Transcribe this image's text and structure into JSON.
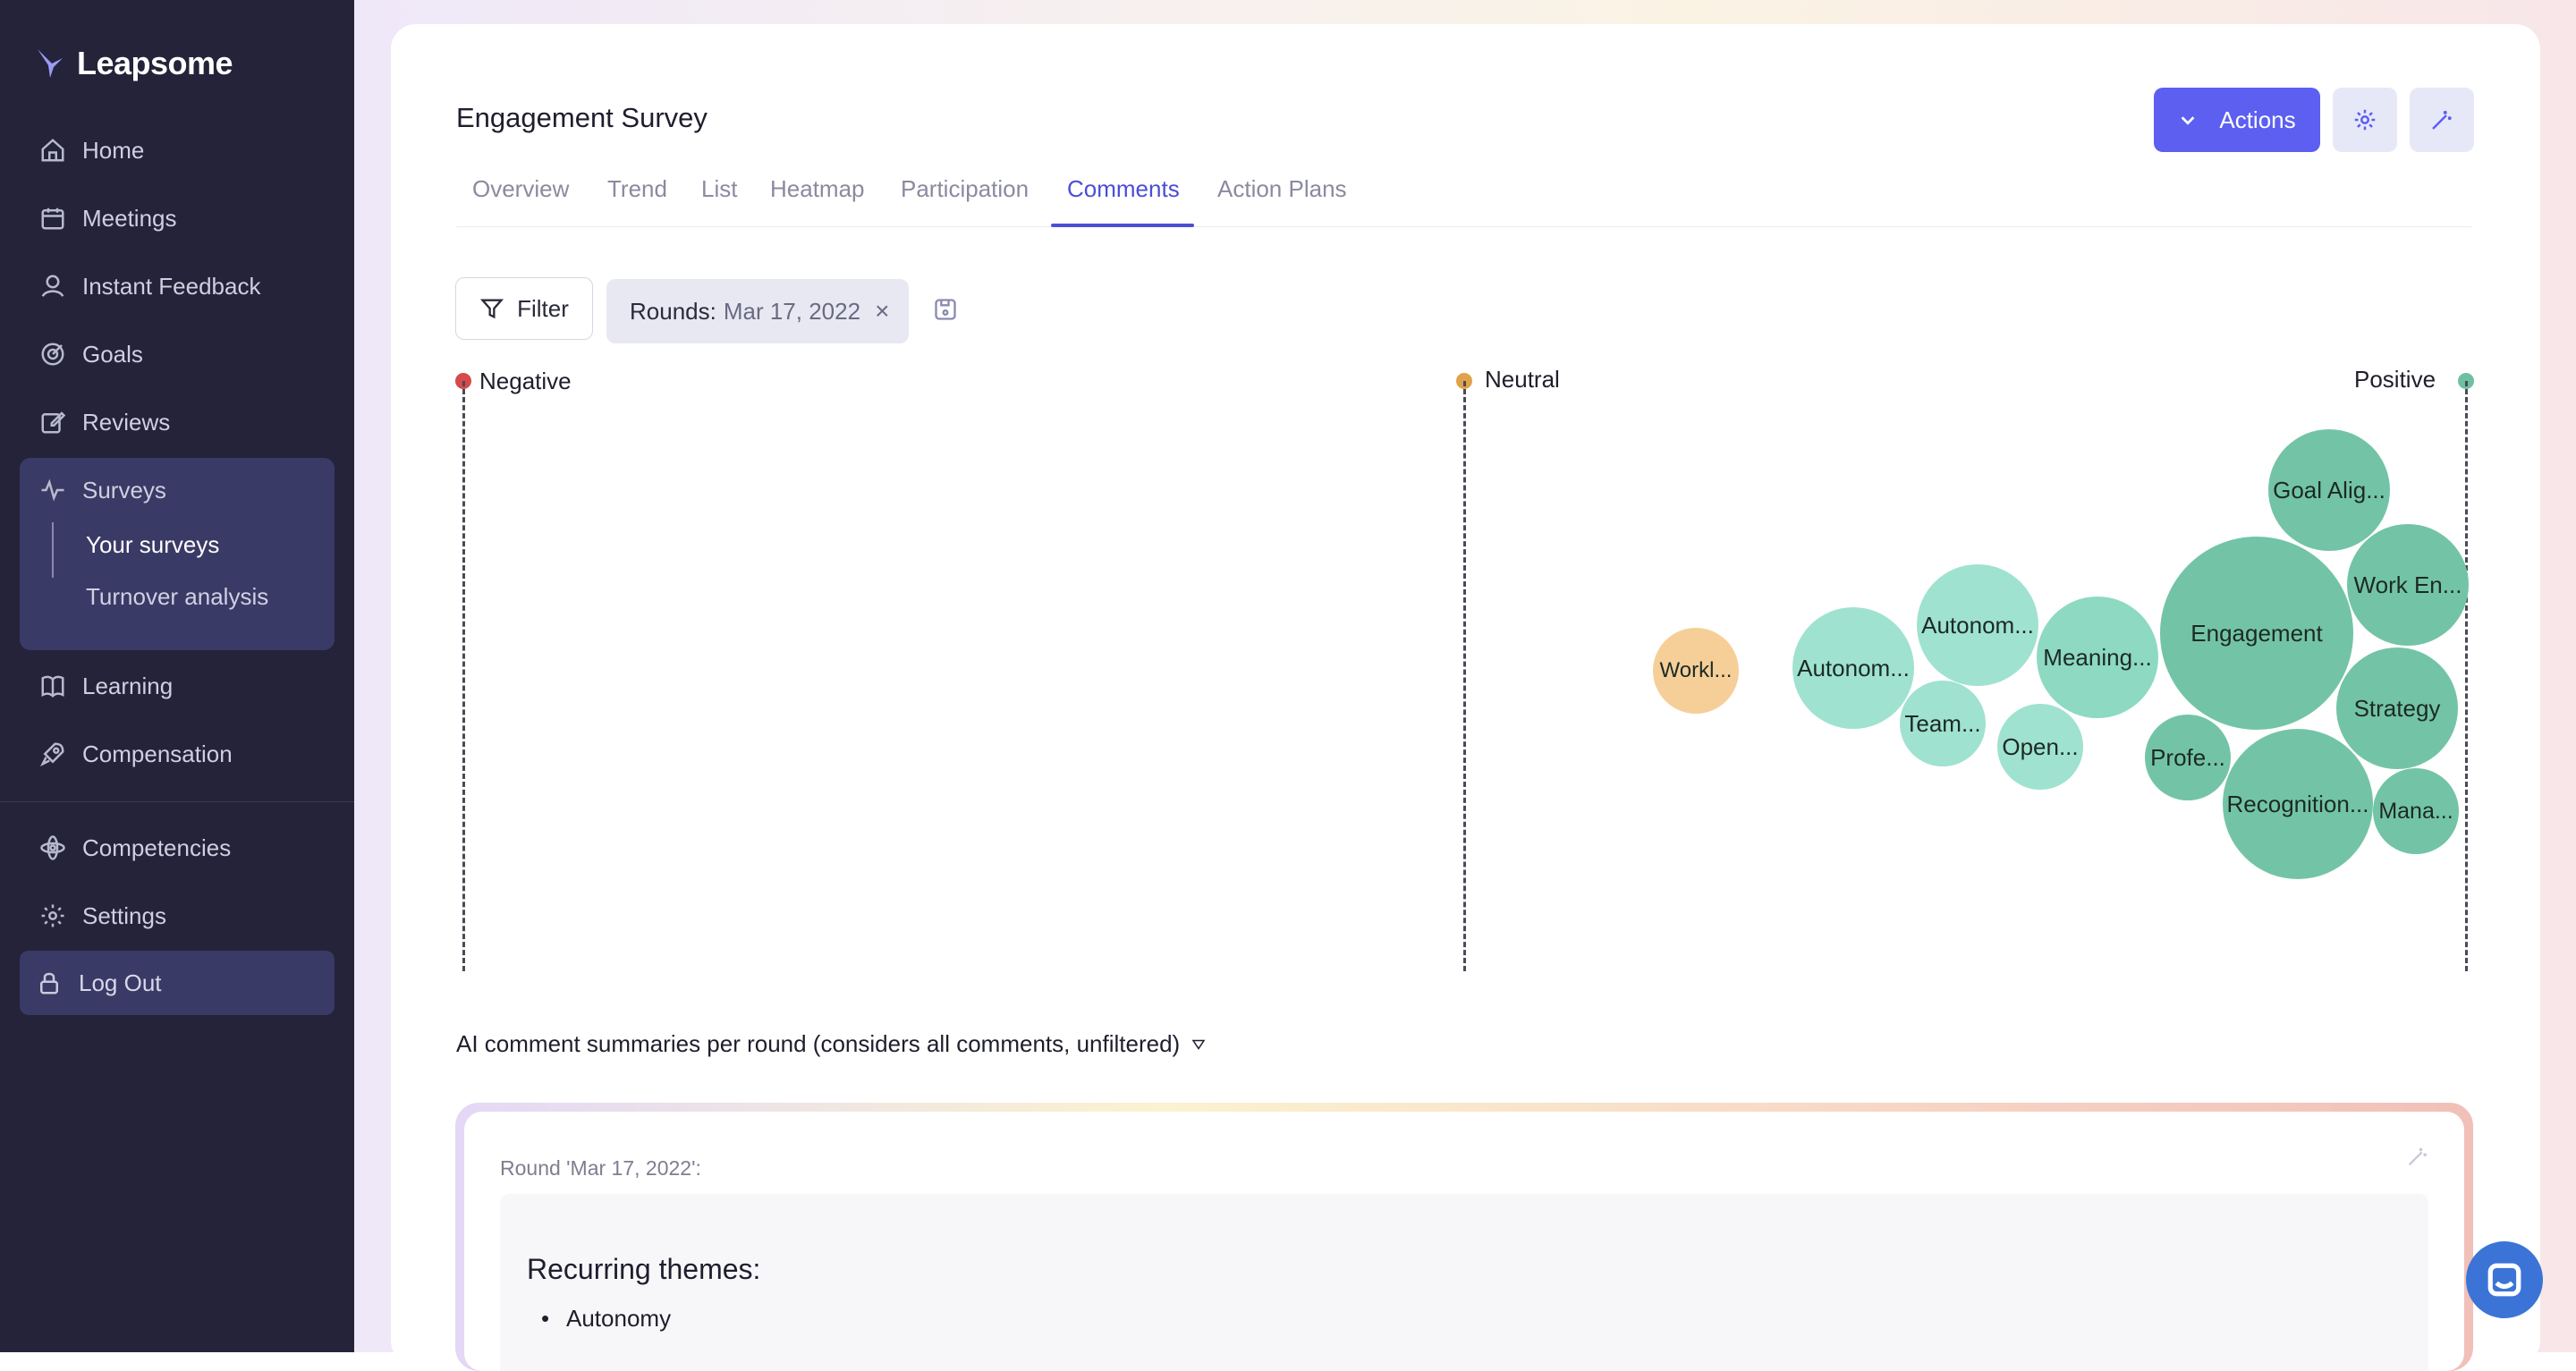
{
  "app": {
    "logo_text": "Leapsome"
  },
  "sidebar": {
    "items": [
      {
        "label": "Home",
        "icon": "home-icon"
      },
      {
        "label": "Meetings",
        "icon": "calendar-icon"
      },
      {
        "label": "Instant Feedback",
        "icon": "feedback-icon"
      },
      {
        "label": "Goals",
        "icon": "target-icon"
      },
      {
        "label": "Reviews",
        "icon": "edit-icon"
      },
      {
        "label": "Surveys",
        "icon": "pulse-icon"
      },
      {
        "label": "Learning",
        "icon": "book-icon"
      },
      {
        "label": "Compensation",
        "icon": "rocket-icon"
      },
      {
        "label": "Competencies",
        "icon": "atom-icon"
      },
      {
        "label": "Settings",
        "icon": "gear-icon"
      }
    ],
    "survey_subitems": [
      {
        "label": "Your surveys",
        "active": true
      },
      {
        "label": "Turnover analysis",
        "active": false
      }
    ],
    "logout_label": "Log Out"
  },
  "header": {
    "title": "Engagement Survey",
    "actions_label": "Actions",
    "tabs": [
      {
        "label": "Overview"
      },
      {
        "label": "Trend"
      },
      {
        "label": "List"
      },
      {
        "label": "Heatmap"
      },
      {
        "label": "Participation"
      },
      {
        "label": "Comments",
        "active": true
      },
      {
        "label": "Action Plans"
      }
    ]
  },
  "filters": {
    "filter_label": "Filter",
    "round_prefix": "Rounds:",
    "round_value": "Mar 17, 2022",
    "remove_symbol": "×"
  },
  "chart_data": {
    "type": "bubble",
    "axis_labels": {
      "negative": "Negative",
      "neutral": "Neutral",
      "positive": "Positive"
    },
    "colors": {
      "negative": "#d64a4a",
      "neutral": "#e0a24a",
      "positive": "#6ec0a0"
    },
    "bubbles": [
      {
        "label": "Workl...",
        "color": "#f6cf98"
      },
      {
        "label": "Autonom...",
        "color": "#9fe2cf"
      },
      {
        "label": "Autonom...",
        "color": "#9fe2cf"
      },
      {
        "label": "Team...",
        "color": "#9fe2cf"
      },
      {
        "label": "Open...",
        "color": "#9fe2cf"
      },
      {
        "label": "Meaning...",
        "color": "#8dd9c1"
      },
      {
        "label": "Engagement",
        "color": "#73c4a7"
      },
      {
        "label": "Goal Alig...",
        "color": "#73c4a7"
      },
      {
        "label": "Work En...",
        "color": "#73c4a7"
      },
      {
        "label": "Strategy",
        "color": "#73c4a7"
      },
      {
        "label": "Profe...",
        "color": "#73c4a7"
      },
      {
        "label": "Recognition...",
        "color": "#73c4a7"
      },
      {
        "label": "Mana...",
        "color": "#73c4a7"
      }
    ]
  },
  "summary": {
    "toggle_label": "AI comment summaries per round (considers all comments, unfiltered)",
    "round_label": "Round 'Mar 17, 2022':",
    "themes_title": "Recurring themes:",
    "themes": [
      "Autonomy"
    ]
  },
  "colors": {
    "accent": "#5c5ff0",
    "sidebar_bg": "#24233a"
  }
}
